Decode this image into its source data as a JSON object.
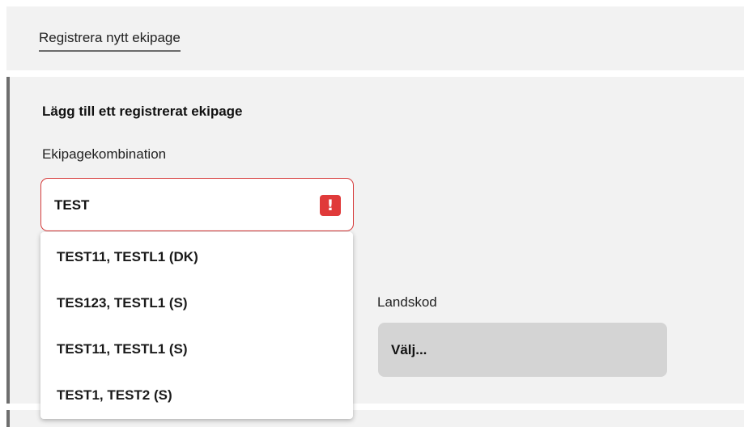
{
  "top": {
    "register_link": "Registrera nytt ekipage"
  },
  "form": {
    "heading": "Lägg till ett registrerat ekipage",
    "combination_label": "Ekipagekombination",
    "combination_value": "TEST",
    "error_icon_glyph": "!",
    "country_label": "Landskod",
    "country_value": "Välj..."
  },
  "suggestions": [
    "TEST11, TESTL1 (DK)",
    "TES123, TESTL1 (S)",
    "TEST11, TESTL1 (S)",
    "TEST1, TEST2 (S)"
  ],
  "colors": {
    "error": "#e03a3a",
    "panel": "#f2f2f2",
    "accent_bar": "#6e6e6e",
    "select_bg": "#d4d4d4"
  }
}
